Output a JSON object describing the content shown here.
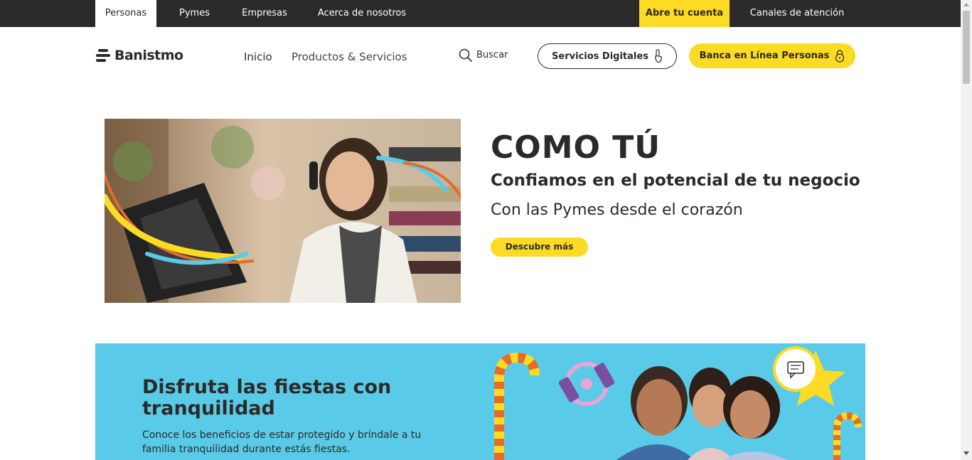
{
  "topnav": {
    "tabs": [
      {
        "label": "Personas"
      },
      {
        "label": "Pymes"
      },
      {
        "label": "Empresas"
      },
      {
        "label": "Acerca de nosotros"
      }
    ],
    "cta": "Abre tu cuenta",
    "support": "Canales de atención"
  },
  "header": {
    "logo": "Banistmo",
    "nav": [
      "Inicio",
      "Productos & Servicios"
    ],
    "search_label": "Buscar",
    "digital_services": "Servicios Digitales",
    "online_banking": "Banca en Línea Personas"
  },
  "hero": {
    "title": "COMO TÚ",
    "subtitle": "Confiamos en el potencial de tu negocio",
    "tagline": "Con las Pymes desde el corazón",
    "button": "Descubre más"
  },
  "promo": {
    "title": "Disfruta las fiestas con tranquilidad",
    "text": "Conoce los beneficios de estar protegido y bríndale a tu familia tranquilidad durante estás fiestas."
  },
  "colors": {
    "brand_dark": "#2c2a29",
    "brand_yellow": "#fdda24",
    "promo_blue": "#59cbe8"
  }
}
